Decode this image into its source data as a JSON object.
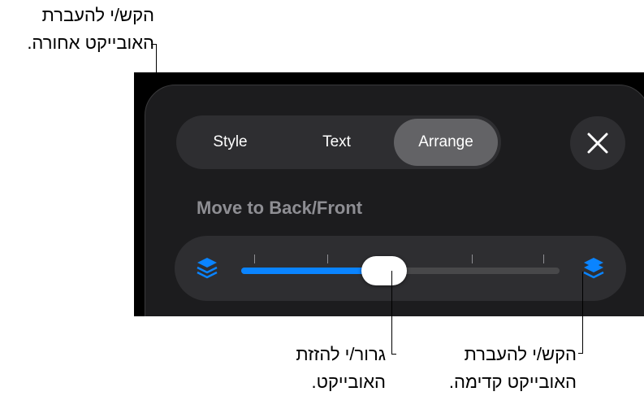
{
  "callouts": {
    "move_back": {
      "line1": "הקש/י להעברת",
      "line2": "האובייקט אחורה."
    },
    "drag": {
      "line1": "גרור/י להזזת",
      "line2": "האובייקט."
    },
    "move_front": {
      "line1": "הקש/י להעברת",
      "line2": "האובייקט קדימה."
    }
  },
  "tabs": [
    {
      "label": "Style",
      "active": false
    },
    {
      "label": "Text",
      "active": false
    },
    {
      "label": "Arrange",
      "active": true
    }
  ],
  "close_icon": "close-icon",
  "section": {
    "title": "Move to Back/Front"
  },
  "slider": {
    "value_fraction": 0.45,
    "tick_count": 5,
    "accent": "#0a84ff",
    "back_icon": "layers-back-icon",
    "front_icon": "layers-front-icon"
  },
  "colors": {
    "panel_bg": "#1c1c1e",
    "control_bg": "#2e2e31",
    "active_tab": "#636366"
  }
}
